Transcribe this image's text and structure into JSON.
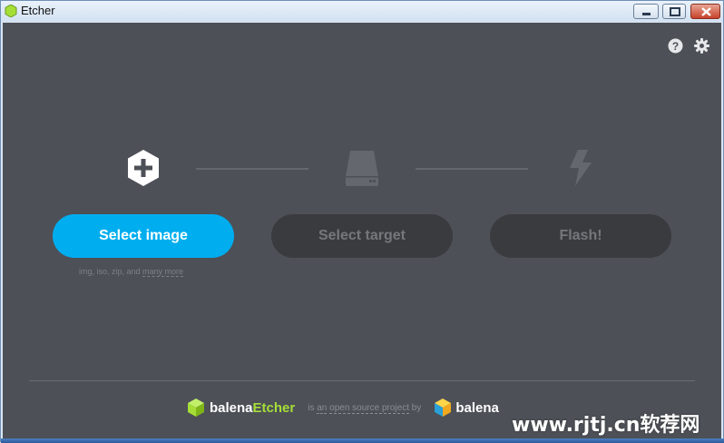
{
  "window": {
    "title": "Etcher"
  },
  "header": {
    "help_icon": "question-circle-icon",
    "settings_icon": "gear-icon"
  },
  "steps": [
    {
      "icon": "plus-hexagon-icon",
      "button_label": "Select image",
      "state": "active"
    },
    {
      "icon": "drive-icon",
      "button_label": "Select target",
      "state": "disabled"
    },
    {
      "icon": "lightning-icon",
      "button_label": "Flash!",
      "state": "disabled"
    }
  ],
  "image_formats": {
    "prefix": "img, iso, zip, and",
    "link": "many more"
  },
  "footer": {
    "brand_part1": "balena",
    "brand_part2": "Etcher",
    "tagline_is": "is",
    "tagline_an": "an",
    "tagline_link": "open source project",
    "tagline_by": "by",
    "company": "balena"
  },
  "watermark": "www.rjtj.cn软荐网",
  "colors": {
    "background": "#4d5057",
    "accent": "#00aeef",
    "disabled_button": "#3a3b3f",
    "brand_green": "#a5de37"
  }
}
